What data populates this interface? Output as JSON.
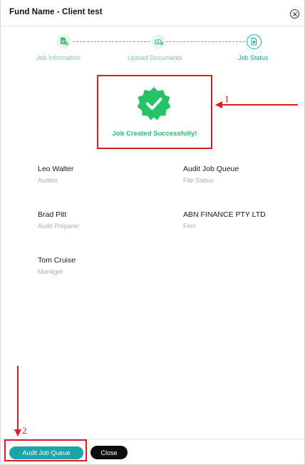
{
  "modal": {
    "title": "Fund Name - Client test"
  },
  "stepper": {
    "steps": [
      {
        "label": "Job Information",
        "icon": "document-check-icon"
      },
      {
        "label": "Upload Documents",
        "icon": "cloud-upload-icon"
      },
      {
        "label": "Job Status",
        "icon": "status-doc-icon",
        "active": true
      }
    ]
  },
  "status": {
    "message": "Job Created Successfully!",
    "icon": "verified-badge-icon",
    "color": "#27c266"
  },
  "details": [
    {
      "value": "Leo Walter",
      "label": "Auditor"
    },
    {
      "value": "Audit Job Queue",
      "label": "File Status"
    },
    {
      "value": "Brad Pitt",
      "label": "Audit Preparer"
    },
    {
      "value": "ABN FINANCE PTY LTD",
      "label": "Firm"
    },
    {
      "value": "Tom Cruise",
      "label": "Manager"
    }
  ],
  "footer": {
    "primary_label": "Audit Job Queue",
    "close_label": "Close"
  },
  "annotations": {
    "one": "1",
    "two": "2",
    "color": "#e01b22"
  },
  "colors": {
    "accent": "#1aa6a6",
    "success": "#27c266"
  }
}
